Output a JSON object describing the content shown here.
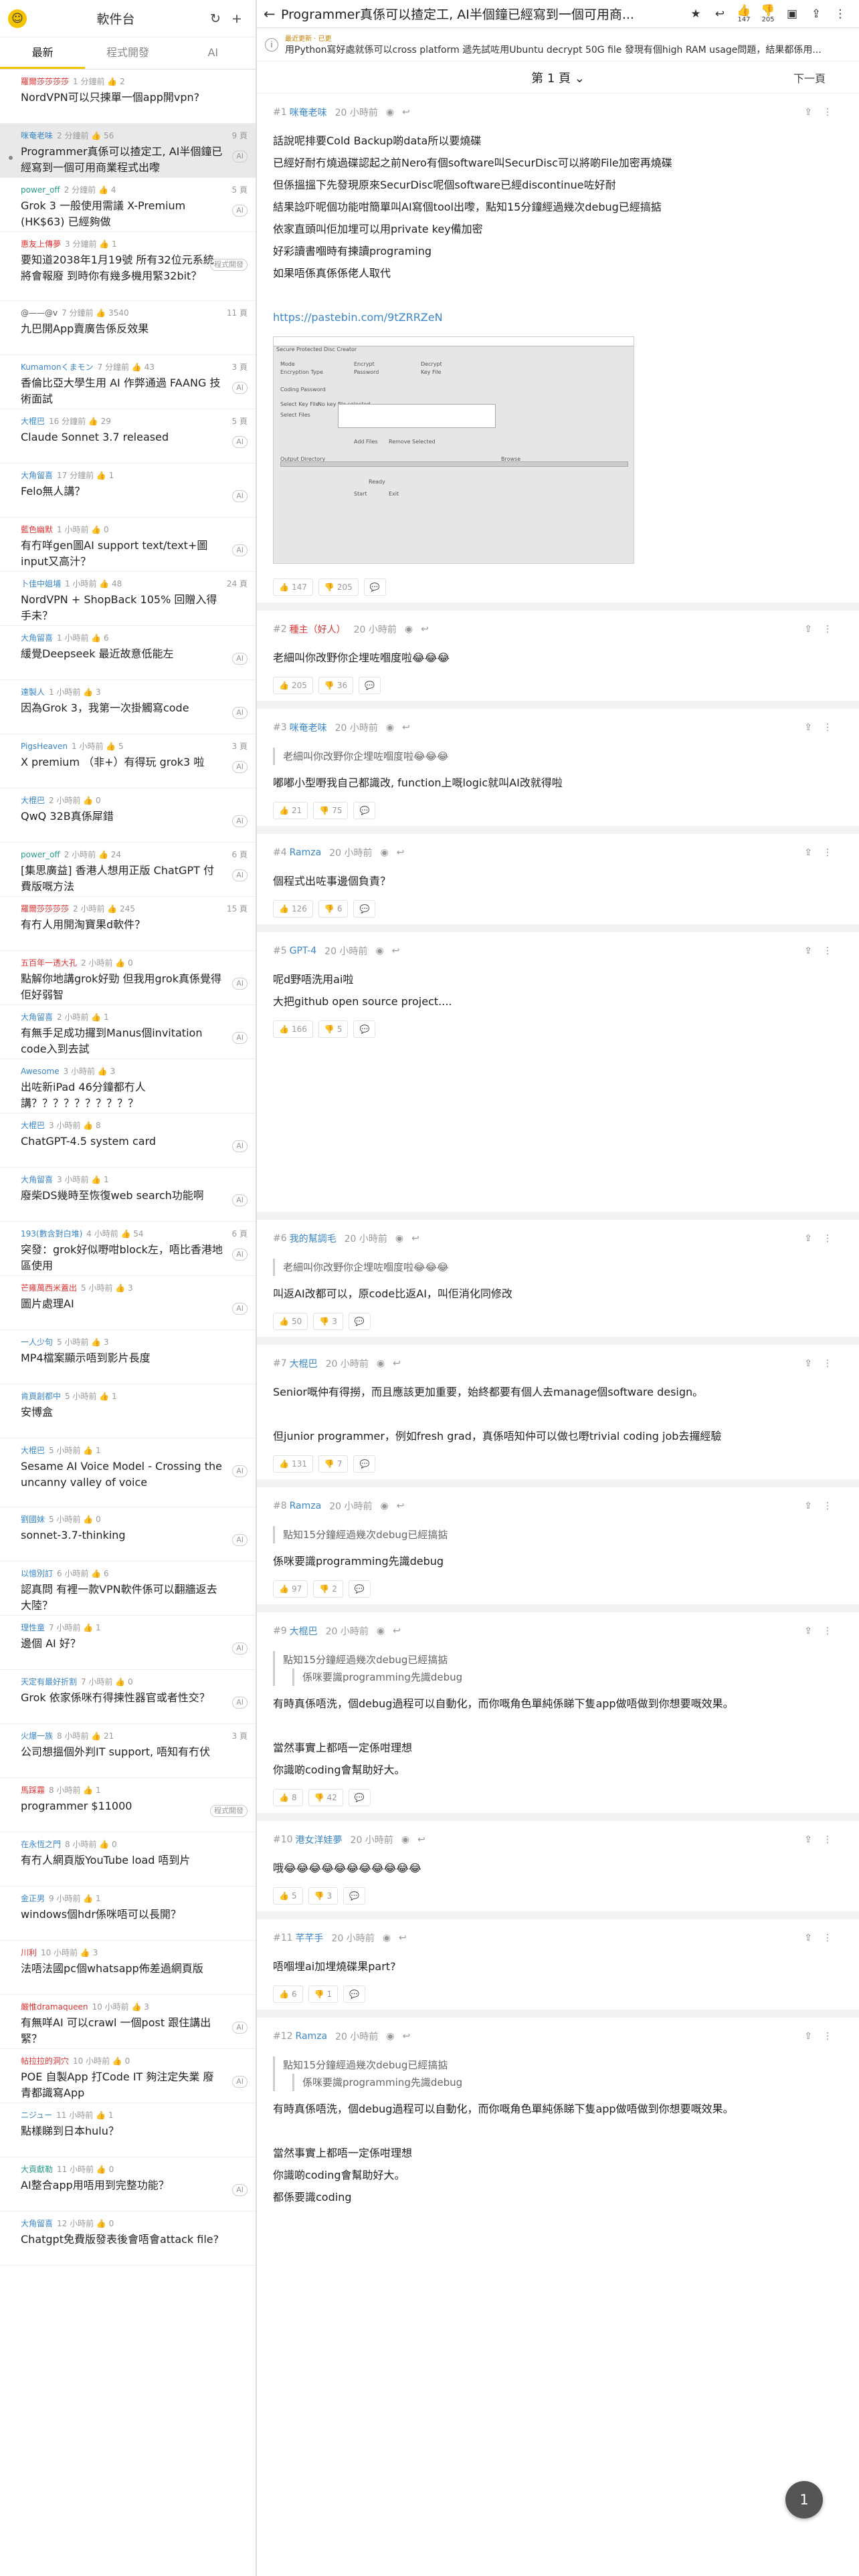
{
  "app": {
    "title": "軟件台",
    "tabs": [
      {
        "label": "最新"
      },
      {
        "label": "程式開發"
      },
      {
        "label": "AI"
      }
    ]
  },
  "threads": [
    {
      "author": "羅爾莎莎莎莎",
      "meta": "1 分鐘前 👍 2",
      "title": "NordVPN可以只揀單一個app開vpn?",
      "color": "red",
      "page": ""
    },
    {
      "author": "咪奄老味",
      "meta": "2 分鐘前 👍 56",
      "title": "Programmer真係可以揸定工, AI半個鐘已經寫到一個可用商業程式出嚟",
      "color": "blue",
      "page": "9 頁",
      "tag": "AI",
      "sel": true
    },
    {
      "author": "power_off",
      "meta": "2 分鐘前 👍 4",
      "title": "Grok 3 一般使用需議 X-Premium (HK$63) 已經夠做",
      "color": "teal",
      "page": "5 頁",
      "tag": "AI"
    },
    {
      "author": "惠友上傳夢",
      "meta": "3 分鐘前 👍 1",
      "title": "要知道2038年1月19號 所有32位元系統將會報廢 到時你有幾多機用緊32bit？",
      "color": "red",
      "page": "",
      "tag": "程式開發"
    },
    {
      "author": "@——@v",
      "meta": "7 分鐘前 👍 3540",
      "title": "九巴開App賣廣告係反效果",
      "color": "dark",
      "page": "11 頁"
    },
    {
      "author": "Kumamonくまモン",
      "meta": "7 分鐘前 👍 43",
      "title": "香倫比亞大學生用 AI 作弊通過 FAANG 技術面試",
      "color": "blue",
      "page": "3 頁",
      "tag": "AI"
    },
    {
      "author": "大棍巴",
      "meta": "16 分鐘前 👍 29",
      "title": "Claude Sonnet 3.7 released",
      "color": "blue",
      "page": "5 頁",
      "tag": "AI"
    },
    {
      "author": "大角留喜",
      "meta": "17 分鐘前 👍 1",
      "title": "Felo無人講？",
      "color": "blue",
      "page": "",
      "tag": "AI"
    },
    {
      "author": "藍色幽默",
      "meta": "1 小時前 👍 0",
      "title": "有冇咩gen圖AI support text/text+圖 input又高汁？",
      "color": "red",
      "page": "",
      "tag": "AI"
    },
    {
      "author": "卜佳中姐埔",
      "meta": "1 小時前 👍 48",
      "title": "NordVPN + ShopBack 105% 回贈入得手未？",
      "color": "blue",
      "page": "24 頁"
    },
    {
      "author": "大角留喜",
      "meta": "1 小時前 👍 6",
      "title": "緩覺Deepseek 最近故意低能左",
      "color": "blue",
      "page": "",
      "tag": "AI"
    },
    {
      "author": "達製人",
      "meta": "1 小時前 👍 3",
      "title": "因為Grok 3，我第一次掛觸寫code",
      "color": "blue",
      "page": "",
      "tag": "AI"
    },
    {
      "author": "PigsHeaven",
      "meta": "1 小時前 👍 5",
      "title": "X premium （非+）有得玩 grok3 啦",
      "color": "blue",
      "page": "3 頁",
      "tag": "AI"
    },
    {
      "author": "大棍巴",
      "meta": "2 小時前 👍 0",
      "title": "QwQ 32B真係犀錯",
      "color": "blue",
      "page": "",
      "tag": "AI"
    },
    {
      "author": "power_off",
      "meta": "2 小時前 👍 24",
      "title": "[集思廣益] 香港人想用正版 ChatGPT 付費版嘅方法",
      "color": "teal",
      "page": "6 頁",
      "tag": "AI"
    },
    {
      "author": "羅爾莎莎莎莎",
      "meta": "2 小時前 👍 245",
      "title": "有冇人用開淘寶果d軟件？",
      "color": "red",
      "page": "15 頁"
    },
    {
      "author": "五百年一透大孔",
      "meta": "2 小時前 👍 0",
      "title": "點解你地講grok好勁 但我用grok真係覺得佢好弱智",
      "color": "red",
      "page": "",
      "tag": "AI"
    },
    {
      "author": "大角留喜",
      "meta": "2 小時前 👍 1",
      "title": "有無手足成功攞到Manus個invitation code入到去試",
      "color": "blue",
      "page": "",
      "tag": "AI"
    },
    {
      "author": "Awesome",
      "meta": "3 小時前 👍 3",
      "title": "出咗新iPad 46分鐘都冇人講？？？？？？？？？？",
      "color": "blue",
      "page": ""
    },
    {
      "author": "大棍巴",
      "meta": "3 小時前 👍 8",
      "title": "ChatGPT-4.5 system card",
      "color": "blue",
      "page": "",
      "tag": "AI"
    },
    {
      "author": "大角留喜",
      "meta": "3 小時前 👍 1",
      "title": "廢柴DS幾時至恢復web search功能啊",
      "color": "blue",
      "page": "",
      "tag": "AI"
    },
    {
      "author": "193(數含對白堆)",
      "meta": "4 小時前 👍 54",
      "title": "突發：grok好似嘢咁block左，唔比香港地區使用",
      "color": "blue",
      "page": "6 頁",
      "tag": "AI"
    },
    {
      "author": "芒雍萬西米蓋出",
      "meta": "5 小時前 👍 3",
      "title": "圖片處理AI",
      "color": "red",
      "page": "",
      "tag": "AI"
    },
    {
      "author": "一人少句",
      "meta": "5 小時前 👍 3",
      "title": "MP4檔案顯示唔到影片長度",
      "color": "blue",
      "page": ""
    },
    {
      "author": "肯頁創都中",
      "meta": "5 小時前 👍 1",
      "title": "安博盒",
      "color": "blue",
      "page": ""
    },
    {
      "author": "大棍巴",
      "meta": "5 小時前 👍 1",
      "title": "Sesame AI Voice Model - Crossing the uncanny valley of voice",
      "color": "blue",
      "page": "",
      "tag": "AI"
    },
    {
      "author": "劉國妹",
      "meta": "5 小時前 👍 0",
      "title": "sonnet-3.7-thinking",
      "color": "blue",
      "page": "",
      "tag": "AI"
    },
    {
      "author": "以憶別訂",
      "meta": "6 小時前 👍 6",
      "title": "認真問 有裡一款VPN軟件係可以翻牆返去大陸？",
      "color": "blue",
      "page": ""
    },
    {
      "author": "理性童",
      "meta": "7 小時前 👍 1",
      "title": "邊個 AI 好？",
      "color": "blue",
      "page": "",
      "tag": "AI"
    },
    {
      "author": "天定有最好折割",
      "meta": "7 小時前 👍 0",
      "title": "Grok 依家係咪冇得揀性器官或者性交？",
      "color": "blue",
      "page": "",
      "tag": "AI"
    },
    {
      "author": "火爆一族",
      "meta": "8 小時前 👍 21",
      "title": "公司想搵個外判IT support, 唔知有冇伏",
      "color": "blue",
      "page": "3 頁"
    },
    {
      "author": "馬踩霧",
      "meta": "8 小時前 👍 1",
      "title": "programmer $11000",
      "color": "red",
      "page": "",
      "tag": "程式開發"
    },
    {
      "author": "在永恆之門",
      "meta": "8 小時前 👍 0",
      "title": "有冇人網頁版YouTube load 唔到片",
      "color": "blue",
      "page": ""
    },
    {
      "author": "金正男",
      "meta": "9 小時前 👍 1",
      "title": "windows個hdr係咪唔可以長開？",
      "color": "blue",
      "page": ""
    },
    {
      "author": "川利",
      "meta": "10 小時前 👍 3",
      "title": "法唔法國pc個whatsapp佈差過網頁版",
      "color": "red",
      "page": ""
    },
    {
      "author": "嚴惟dramaqueen",
      "meta": "10 小時前 👍 3",
      "title": "有無咩AI 可以crawl 一個post 跟住講出緊？",
      "color": "red",
      "page": "",
      "tag": "AI"
    },
    {
      "author": "帖拉拉的洞穴",
      "meta": "10 小時前 👍 0",
      "title": "POE 自製App 打Code IT 夠注定失業 廢青都識寫App",
      "color": "red",
      "page": "",
      "tag": "AI"
    },
    {
      "author": "ニジュー",
      "meta": "11 小時前 👍 1",
      "title": "點樣睇到日本hulu？",
      "color": "blue",
      "page": ""
    },
    {
      "author": "大貢獻勒",
      "meta": "11 小時前 👍 0",
      "title": "AI整合app用唔用到完整功能？",
      "color": "teal",
      "page": "",
      "tag": "AI"
    },
    {
      "author": "大角留喜",
      "meta": "12 小時前 👍 0",
      "title": "Chatgpt免費版發表後會唔會attack file?",
      "color": "blue",
      "page": ""
    }
  ],
  "topbar": {
    "title": "Programmer真係可以揸定工, AI半個鐘已經寫到一個可用商...",
    "like_count": "147",
    "dislike_count": "205"
  },
  "banner": {
    "tag": "最近更新 · 已更",
    "text": "用Python寫好處就係可以cross platform 遞先試咗用Ubuntu decrypt 50G file 發現有個high RAM usage問題，結果都係用..."
  },
  "pager": {
    "page": "第 1 頁",
    "next": "下一頁"
  },
  "replies": [
    {
      "no": "#1",
      "name": "咪奄老味",
      "time": "20 小時前",
      "red": false,
      "lines": [
        "話說呢排要Cold Backup啲data所以要燒碟",
        "已經好耐冇燒過碟認起之前Nero有個software叫SecurDisc可以將啲File加密再燒碟",
        "但係搵搵下先發現原來SecurDisc呢個software已經discontinue咗好耐",
        "結果諗吓呢個功能咁簡單叫AI寫個tool出嚟，點知15分鐘經過幾次debug已經搞掂",
        "依家直頭叫佢加埋可以用private key備加密",
        "好彩讀書嗰時有揀讀programing",
        "如果唔係真係係佬人取代"
      ],
      "link": "https://pastebin.com/9tZRRZeN",
      "up": "147",
      "down": "205"
    },
    {
      "no": "#2",
      "name": "種主（好人）",
      "time": "20 小時前",
      "red": true,
      "lines": [
        "老細叫你改野你企埋咗嗰度啦😂😂😂"
      ],
      "up": "205",
      "down": "36"
    },
    {
      "no": "#3",
      "name": "咪奄老味",
      "time": "20 小時前",
      "red": false,
      "quote": "老細叫你改野你企埋咗嗰度啦😂😂😂",
      "lines": [
        "嘟嘟小型嘢我自己都識改, function上嘅logic就叫AI改就得啦"
      ],
      "up": "21",
      "down": "75"
    },
    {
      "no": "#4",
      "name": "Ramza",
      "time": "20 小時前",
      "red": false,
      "lines": [
        "個程式出咗事邊個負責？"
      ],
      "up": "126",
      "down": "6"
    },
    {
      "no": "#5",
      "name": "GPT-4",
      "time": "20 小時前",
      "red": false,
      "lines": [
        "呢d野唔洗用ai啦",
        "大把github open source project...."
      ],
      "up": "166",
      "down": "5"
    },
    {
      "no": "#6",
      "name": "我的幫調毛",
      "time": "20 小時前",
      "red": false,
      "quote": "老細叫你改野你企埋咗嗰度啦😂😂😂",
      "lines": [
        "叫返AI改都可以，原code比返AI，叫佢消化同修改"
      ],
      "up": "50",
      "down": "3"
    },
    {
      "no": "#7",
      "name": "大棍巴",
      "time": "20 小時前",
      "red": false,
      "lines": [
        "Senior嘅仲有得撈，而且應該更加重要，始終都要有個人去manage個software design。",
        "",
        "但junior programmer，例如fresh grad，真係唔知仲可以做乜嘢trivial coding job去攞經驗"
      ],
      "up": "131",
      "down": "7"
    },
    {
      "no": "#8",
      "name": "Ramza",
      "time": "20 小時前",
      "red": false,
      "quote": "點知15分鐘經過幾次debug已經搞掂",
      "lines": [
        "係咪要識programming先識debug"
      ],
      "up": "97",
      "down": "2"
    },
    {
      "no": "#9",
      "name": "大棍巴",
      "time": "20 小時前",
      "red": false,
      "quote": "點知15分鐘經過幾次debug已經搞掂",
      "quote2": "係咪要識programming先識debug",
      "lines": [
        "有時真係唔洗，個debug過程可以自動化，而你嘅角色單純係睇下隻app做唔做到你想要嘅效果。",
        "",
        "當然事實上都唔一定係咁理想",
        "你識啲coding會幫助好大。"
      ],
      "up": "8",
      "down": "42"
    },
    {
      "no": "#10",
      "name": "港女洋娃夢",
      "time": "20 小時前",
      "red": false,
      "lines": [
        "哦😂😂😂😂😂😂😂😂😂😂😂"
      ],
      "up": "5",
      "down": "3"
    },
    {
      "no": "#11",
      "name": "芊芊手",
      "time": "20 小時前",
      "red": false,
      "lines": [
        "唔嗰埋ai加埋燒碟果part?"
      ],
      "up": "6",
      "down": "1"
    },
    {
      "no": "#12",
      "name": "Ramza",
      "time": "20 小時前",
      "red": false,
      "quote": "點知15分鐘經過幾次debug已經搞掂",
      "quote2": "係咪要識programming先識debug",
      "lines": [
        "有時真係唔洗，個debug過程可以自動化，而你嘅角色單純係睇下隻app做唔做到你想要嘅效果。",
        "",
        "當然事實上都唔一定係咁理想",
        "你識啲coding會幫助好大。",
        "都係要識coding"
      ],
      "up": "",
      "down": ""
    }
  ],
  "screenshot": {
    "window_title": "Secure Protected Disc Creator",
    "labels": [
      "Mode",
      "Encryption Type",
      "Coding Password",
      "Select Key File",
      "No key file selected",
      "Select Files",
      "Add Files",
      "Remove Selected",
      "Output Directory",
      "Browse",
      "Ready",
      "Start",
      "Exit"
    ],
    "opts": [
      "Encrypt",
      "Decrypt",
      "Password",
      "Key File"
    ]
  },
  "fab": {
    "label": "1"
  }
}
